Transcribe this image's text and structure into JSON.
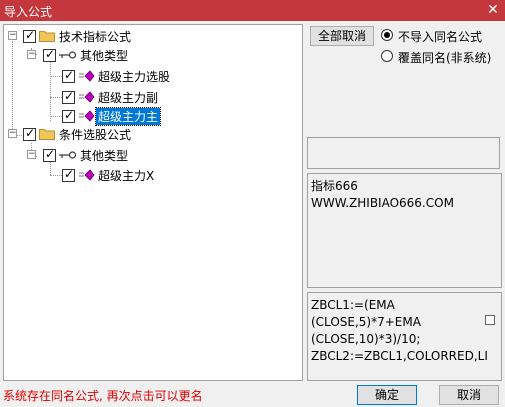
{
  "window": {
    "title": "导入公式",
    "close_glyph": "✕"
  },
  "tree": {
    "groups": [
      {
        "label": "技术指标公式",
        "checked": true,
        "expander": "−",
        "category": {
          "label": "其他类型",
          "checked": true,
          "expander": "−"
        },
        "items": [
          {
            "label": "超级主力选股",
            "checked": true,
            "selected": false
          },
          {
            "label": "超级主力副",
            "checked": true,
            "selected": false
          },
          {
            "label": "超级主力主",
            "checked": true,
            "selected": true
          }
        ]
      },
      {
        "label": "条件选股公式",
        "checked": true,
        "expander": "−",
        "category": {
          "label": "其他类型",
          "checked": true,
          "expander": "−"
        },
        "items": [
          {
            "label": "超级主力X",
            "checked": true,
            "selected": false
          }
        ]
      }
    ]
  },
  "controls": {
    "deselect_all_label": "全部取消",
    "radio_options": [
      {
        "label": "不导入同名公式",
        "selected": true
      },
      {
        "label": "覆盖同名(非系统)",
        "selected": false
      }
    ]
  },
  "description": {
    "lines": [
      "指标666",
      "WWW.ZHIBIAO666.COM"
    ]
  },
  "code": {
    "lines": [
      "ZBCL1:=(EMA",
      "(CLOSE,5)*7+EMA",
      "(CLOSE,10)*3)/10;",
      "ZBCL2:=ZBCL1,COLORRED,LI"
    ]
  },
  "footer": {
    "status_text": "系统存在同名公式, 再次点击可以更名",
    "ok_label": "确定",
    "cancel_label": "取消"
  },
  "colors": {
    "titlebar": "#c4373d",
    "selection": "#0078d7",
    "status_text": "#e00000",
    "folder": "#f0c65a",
    "formula_icon": "#c000c0"
  }
}
